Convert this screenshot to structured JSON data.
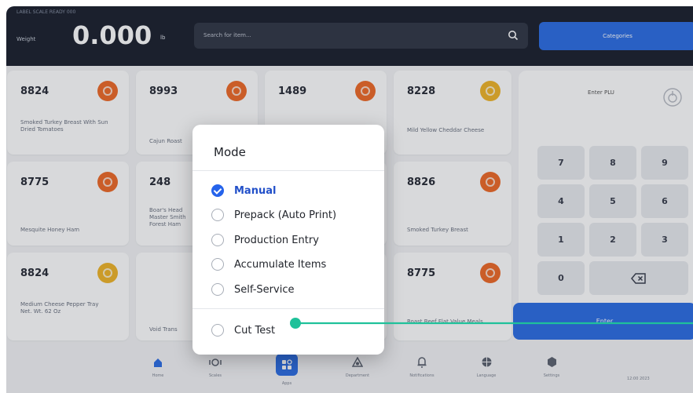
{
  "header": {
    "status_line": "LABEL SCALE  READY  000",
    "weight_label": "Weight",
    "weight_value": "0.000",
    "weight_unit": "lb",
    "search_placeholder": "Search for item...",
    "categories_label": "Categories"
  },
  "tiles": [
    {
      "code": "8824",
      "name": "Smoked Turkey Breast With Sun Dried Tomatoes",
      "icon": "orange"
    },
    {
      "code": "8993",
      "name": "Cajun Roast",
      "icon": "orange"
    },
    {
      "code": "1489",
      "name": "",
      "icon": "orange"
    },
    {
      "code": "8228",
      "name": "Mild Yellow Cheddar Cheese",
      "icon": "yellow"
    },
    {
      "code": "8775",
      "name": "Mesquite Honey Ham",
      "icon": "orange"
    },
    {
      "code": "248",
      "name": "Boar's Head Master Smith Forest Ham",
      "icon": ""
    },
    {
      "code": "8826",
      "name": "Smoked Turkey Breast",
      "icon": "orange"
    },
    {
      "code": "8824",
      "name": "Medium Cheese Pepper Tray Net. Wt. 62 Oz",
      "icon": "yellow"
    },
    {
      "code": "",
      "name": "Void Trans",
      "icon": ""
    },
    {
      "code": "8775",
      "name": "Roast Beef Flat Value Meals",
      "icon": "orange"
    }
  ],
  "keypad": {
    "plu_label": "Enter PLU",
    "keys": [
      "7",
      "8",
      "9",
      "4",
      "5",
      "6",
      "1",
      "2",
      "3",
      "0"
    ],
    "enter_label": "Enter"
  },
  "nav": {
    "items": [
      "Home",
      "Scales",
      "Apps",
      "Department",
      "Notifications",
      "Language",
      "Settings"
    ],
    "footer": "12:00  2023"
  },
  "dialog": {
    "title": "Mode",
    "options": [
      {
        "label": "Manual",
        "selected": true
      },
      {
        "label": "Prepack (Auto Print)",
        "selected": false
      },
      {
        "label": "Production Entry",
        "selected": false
      },
      {
        "label": "Accumulate Items",
        "selected": false
      },
      {
        "label": "Self-Service",
        "selected": false
      }
    ],
    "cut_test_label": "Cut Test"
  },
  "colors": {
    "accent": "#2f6fe4",
    "header": "#1e2330",
    "callout": "#1fc19a",
    "orange": "#ef6c2a",
    "yellow": "#f0b52b"
  }
}
